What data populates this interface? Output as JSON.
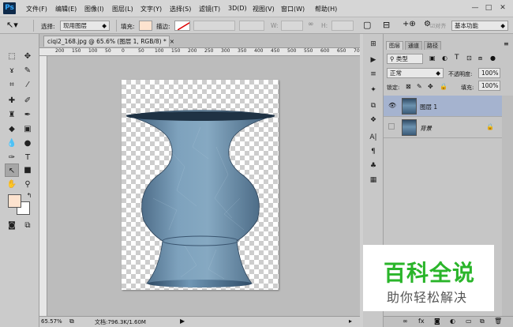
{
  "app": {
    "logo": "Ps"
  },
  "menu": [
    "文件(F)",
    "编辑(E)",
    "图像(I)",
    "图层(L)",
    "文字(Y)",
    "选择(S)",
    "滤镜(T)",
    "3D(D)",
    "视图(V)",
    "窗口(W)",
    "帮助(H)"
  ],
  "window_controls": {
    "minimize": "—",
    "restore": "□",
    "close": "✕"
  },
  "options": {
    "select_label": "选择:",
    "select_value": "现用图层",
    "fill_label": "填充:",
    "stroke_label": "描边:",
    "w_label": "W:",
    "h_label": "H:",
    "align_label": "对齐",
    "workspace": "基本功能"
  },
  "document": {
    "tab_label": "ciqi2_168.jpg @ 65.6% (图层 1, RGB/8) *",
    "close": "×",
    "ruler_ticks": [
      "200",
      "150",
      "100",
      "50",
      "0",
      "50",
      "100",
      "150",
      "200",
      "250",
      "300",
      "350",
      "400",
      "450",
      "500",
      "550",
      "600",
      "650",
      "700",
      "750"
    ],
    "zoom": "65.57%",
    "doc_info": "文档:796.3K/1.60M"
  },
  "colors": {
    "foreground": "#fde3cf",
    "background": "#ffffff",
    "fill_swatch": "#fde3cf"
  },
  "layers_panel": {
    "tabs": [
      "图层",
      "通道",
      "路径"
    ],
    "filter": "类型",
    "blend_mode": "正常",
    "opacity_label": "不透明度:",
    "opacity": "100%",
    "lock_label": "锁定:",
    "fill_label": "填充:",
    "fill": "100%",
    "layers": [
      {
        "name": "图层 1",
        "visible": true,
        "selected": true
      },
      {
        "name": "背景",
        "visible": false,
        "locked": true
      }
    ],
    "footer_icons": [
      "link-icon",
      "fx-icon",
      "mask-icon",
      "adjustment-icon",
      "group-icon",
      "new-layer-icon",
      "trash-icon"
    ]
  },
  "watermark": {
    "title": "百科全说",
    "subtitle": "助你轻松解决"
  }
}
